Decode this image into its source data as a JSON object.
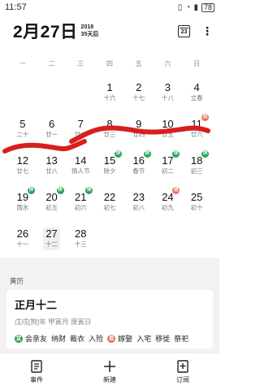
{
  "status_bar": {
    "time": "11:57",
    "battery": "78"
  },
  "header": {
    "date": "2月27日",
    "year": "2018",
    "days_later": "35天后",
    "today_icon_label": "23"
  },
  "weekdays": [
    "一",
    "二",
    "三",
    "四",
    "五",
    "六",
    "日"
  ],
  "calendar": {
    "rows": [
      [
        {
          "day": "",
          "lunar": ""
        },
        {
          "day": "",
          "lunar": ""
        },
        {
          "day": "",
          "lunar": ""
        },
        {
          "day": "1",
          "lunar": "十六"
        },
        {
          "day": "2",
          "lunar": "十七"
        },
        {
          "day": "3",
          "lunar": "十八"
        },
        {
          "day": "4",
          "lunar": "立春"
        }
      ],
      [
        {
          "day": "5",
          "lunar": "二十"
        },
        {
          "day": "6",
          "lunar": "廿一"
        },
        {
          "day": "7",
          "lunar": "廿二"
        },
        {
          "day": "8",
          "lunar": "廿三"
        },
        {
          "day": "9",
          "lunar": "廿四"
        },
        {
          "day": "10",
          "lunar": "廿五"
        },
        {
          "day": "11",
          "lunar": "廿六",
          "badge": "班",
          "badge_type": "work"
        }
      ],
      [
        {
          "day": "12",
          "lunar": "廿七"
        },
        {
          "day": "13",
          "lunar": "廿八"
        },
        {
          "day": "14",
          "lunar": "情人节"
        },
        {
          "day": "15",
          "lunar": "除夕",
          "badge": "休",
          "badge_type": "rest"
        },
        {
          "day": "16",
          "lunar": "春节",
          "badge": "休",
          "badge_type": "rest"
        },
        {
          "day": "17",
          "lunar": "初二",
          "badge": "休",
          "badge_type": "rest"
        },
        {
          "day": "18",
          "lunar": "初三",
          "badge": "休",
          "badge_type": "rest"
        }
      ],
      [
        {
          "day": "19",
          "lunar": "雨水",
          "badge": "休",
          "badge_type": "rest"
        },
        {
          "day": "20",
          "lunar": "初五",
          "badge": "休",
          "badge_type": "rest"
        },
        {
          "day": "21",
          "lunar": "初六",
          "badge": "休",
          "badge_type": "rest"
        },
        {
          "day": "22",
          "lunar": "初七"
        },
        {
          "day": "23",
          "lunar": "初八"
        },
        {
          "day": "24",
          "lunar": "初九",
          "badge": "班",
          "badge_type": "work"
        },
        {
          "day": "25",
          "lunar": "初十"
        }
      ],
      [
        {
          "day": "26",
          "lunar": "十一"
        },
        {
          "day": "27",
          "lunar": "十二",
          "today": true
        },
        {
          "day": "28",
          "lunar": "十三"
        },
        {
          "day": "",
          "lunar": ""
        },
        {
          "day": "",
          "lunar": ""
        },
        {
          "day": "",
          "lunar": ""
        },
        {
          "day": "",
          "lunar": ""
        }
      ]
    ]
  },
  "almanac": {
    "section_title": "黄历",
    "lunar_date": "正月十二",
    "ganzhi": "戊戌[狗]年 甲寅月 庚寅日",
    "yi_label": "宜",
    "yi_items": [
      "会亲友",
      "纳财",
      "裁衣",
      "入殓"
    ],
    "ji_label": "忌",
    "ji_items": [
      "嫁娶",
      "入宅",
      "移徙",
      "祭祀"
    ]
  },
  "bottom_bar": {
    "events_label": "事件",
    "new_label": "新建",
    "subscribe_label": "订阅"
  },
  "colors": {
    "rest_badge": "#2aa357",
    "work_badge": "#e8715a",
    "scribble": "#d81e1e"
  }
}
